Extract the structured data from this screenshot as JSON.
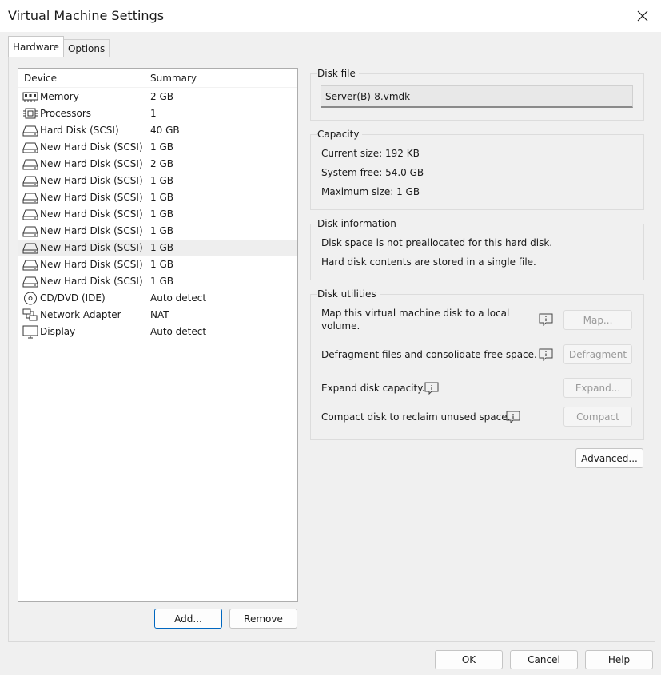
{
  "window": {
    "title": "Virtual Machine Settings",
    "close_icon": "close-icon"
  },
  "tabs": [
    {
      "label": "Hardware",
      "active": true
    },
    {
      "label": "Options",
      "active": false
    }
  ],
  "device_list": {
    "headers": {
      "device": "Device",
      "summary": "Summary"
    },
    "rows": [
      {
        "name": "Memory",
        "summary": "2 GB",
        "icon": "memory-icon"
      },
      {
        "name": "Processors",
        "summary": "1",
        "icon": "processor-icon"
      },
      {
        "name": "Hard Disk (SCSI)",
        "summary": "40 GB",
        "icon": "hard-disk-icon"
      },
      {
        "name": "New Hard Disk (SCSI)",
        "summary": "1 GB",
        "icon": "hard-disk-icon"
      },
      {
        "name": "New Hard Disk (SCSI)",
        "summary": "2 GB",
        "icon": "hard-disk-icon"
      },
      {
        "name": "New Hard Disk (SCSI)",
        "summary": "1 GB",
        "icon": "hard-disk-icon"
      },
      {
        "name": "New Hard Disk (SCSI)",
        "summary": "1 GB",
        "icon": "hard-disk-icon"
      },
      {
        "name": "New Hard Disk (SCSI)",
        "summary": "1 GB",
        "icon": "hard-disk-icon"
      },
      {
        "name": "New Hard Disk (SCSI)",
        "summary": "1 GB",
        "icon": "hard-disk-icon"
      },
      {
        "name": "New Hard Disk (SCSI)",
        "summary": "1 GB",
        "icon": "hard-disk-icon",
        "selected": true
      },
      {
        "name": "New Hard Disk (SCSI)",
        "summary": "1 GB",
        "icon": "hard-disk-icon"
      },
      {
        "name": "New Hard Disk (SCSI)",
        "summary": "1 GB",
        "icon": "hard-disk-icon"
      },
      {
        "name": "CD/DVD (IDE)",
        "summary": "Auto detect",
        "icon": "cd-dvd-icon"
      },
      {
        "name": "Network Adapter",
        "summary": "NAT",
        "icon": "network-adapter-icon"
      },
      {
        "name": "Display",
        "summary": "Auto detect",
        "icon": "display-icon"
      }
    ],
    "add_label": "Add...",
    "remove_label": "Remove"
  },
  "disk_file": {
    "group_label": "Disk file",
    "value": "Server(B)-8.vmdk"
  },
  "capacity": {
    "group_label": "Capacity",
    "current_size": "Current size: 192 KB",
    "system_free": "System free: 54.0 GB",
    "maximum_size": "Maximum size: 1 GB"
  },
  "disk_information": {
    "group_label": "Disk information",
    "line1": "Disk space is not preallocated for this hard disk.",
    "line2": "Hard disk contents are stored in a single file."
  },
  "disk_utilities": {
    "group_label": "Disk utilities",
    "map_text_line1": "Map this virtual machine disk to a local",
    "map_text_line2": "volume.",
    "map_button": "Map...",
    "defrag_text": "Defragment files and consolidate free space.",
    "defrag_button": "Defragment",
    "expand_text": "Expand disk capacity.",
    "expand_button": "Expand...",
    "compact_text": "Compact disk to reclaim unused space.",
    "compact_button": "Compact"
  },
  "advanced_button": "Advanced...",
  "footer": {
    "ok": "OK",
    "cancel": "Cancel",
    "help": "Help"
  },
  "colors": {
    "accent": "#0067c0",
    "selected_row": "#eeeeee"
  }
}
